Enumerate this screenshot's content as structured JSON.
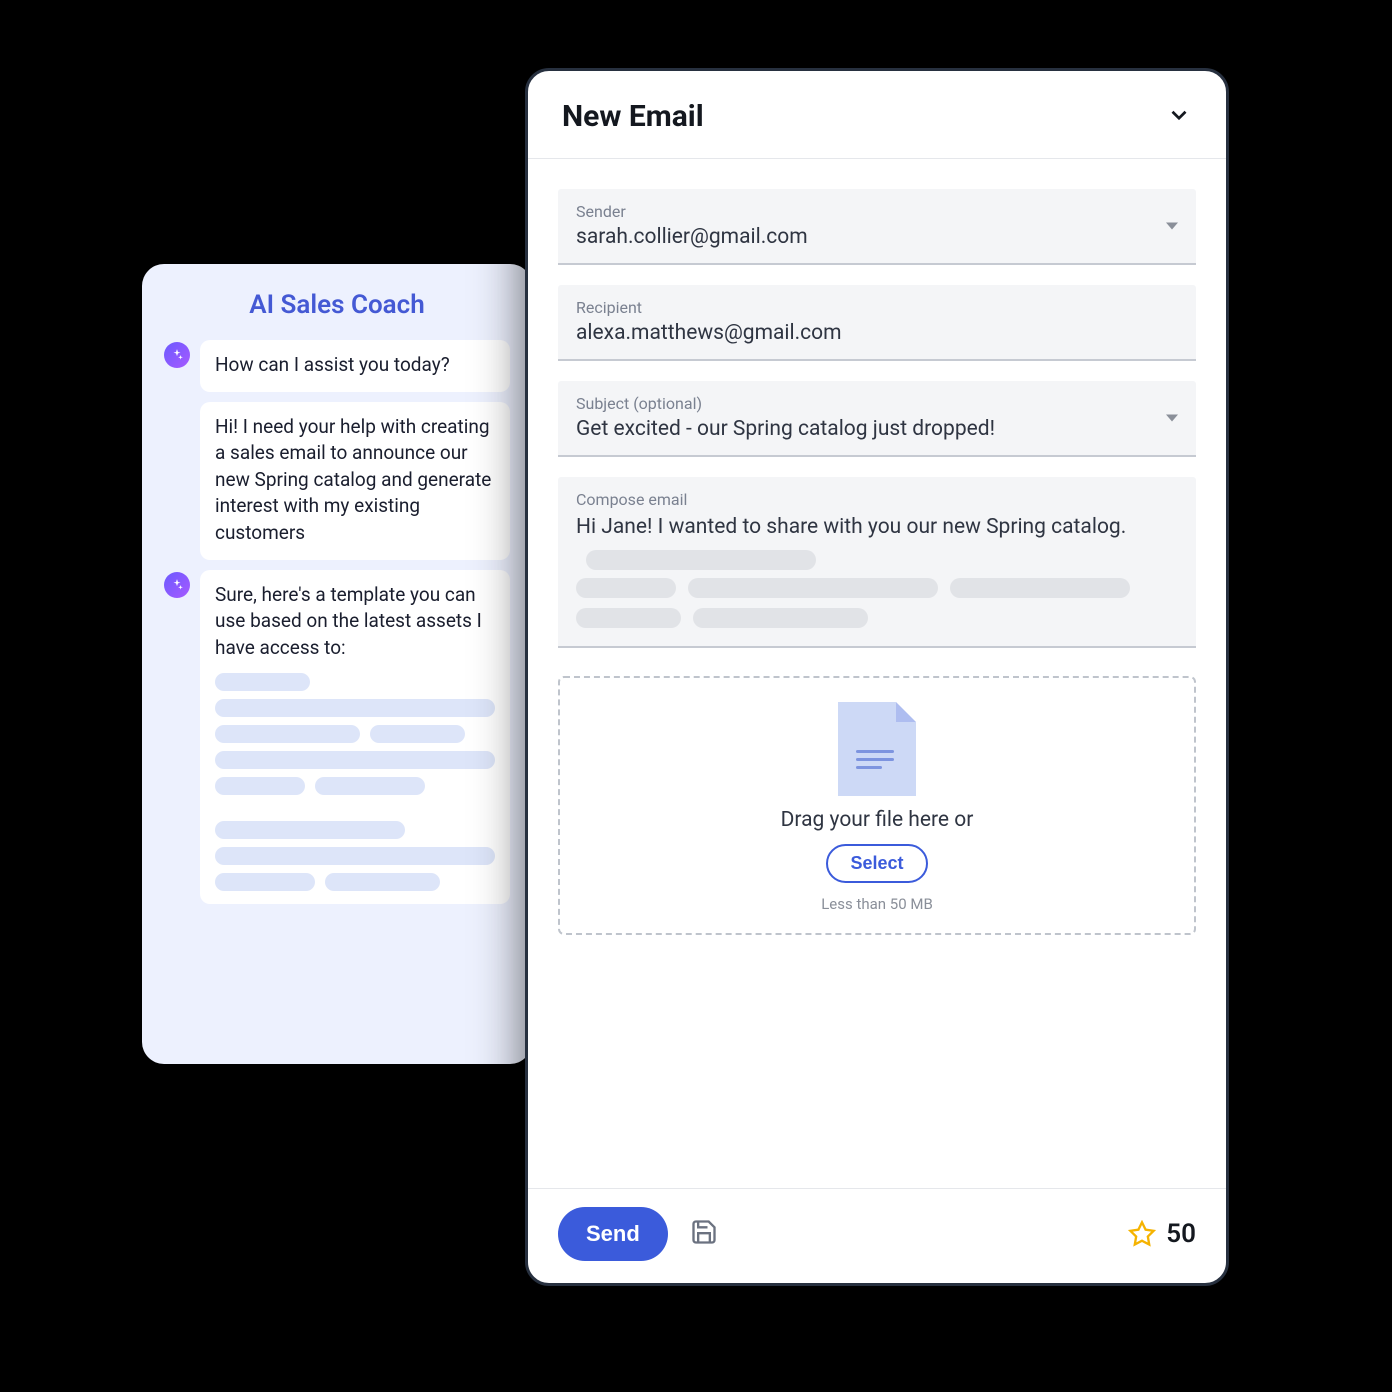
{
  "coach": {
    "title": "AI Sales Coach",
    "messages": {
      "m1": "How can I assist you today?",
      "m2": "Hi! I need your help with creating a sales email to announce our new Spring catalog and generate interest with my existing customers",
      "m3": "Sure, here's a template you can use based on the latest assets I have access to:"
    }
  },
  "email": {
    "title": "New Email",
    "sender_label": "Sender",
    "sender_value": "sarah.collier@gmail.com",
    "recipient_label": "Recipient",
    "recipient_value": "alexa.matthews@gmail.com",
    "subject_label": "Subject (optional)",
    "subject_value": "Get excited - our Spring catalog just dropped!",
    "compose_label": "Compose email",
    "compose_value": "Hi Jane! I wanted to share with you our new Spring catalog.",
    "drop_text": "Drag your file here or",
    "select_label": "Select",
    "size_note": "Less than 50 MB",
    "send_label": "Send",
    "star_count": "50"
  }
}
